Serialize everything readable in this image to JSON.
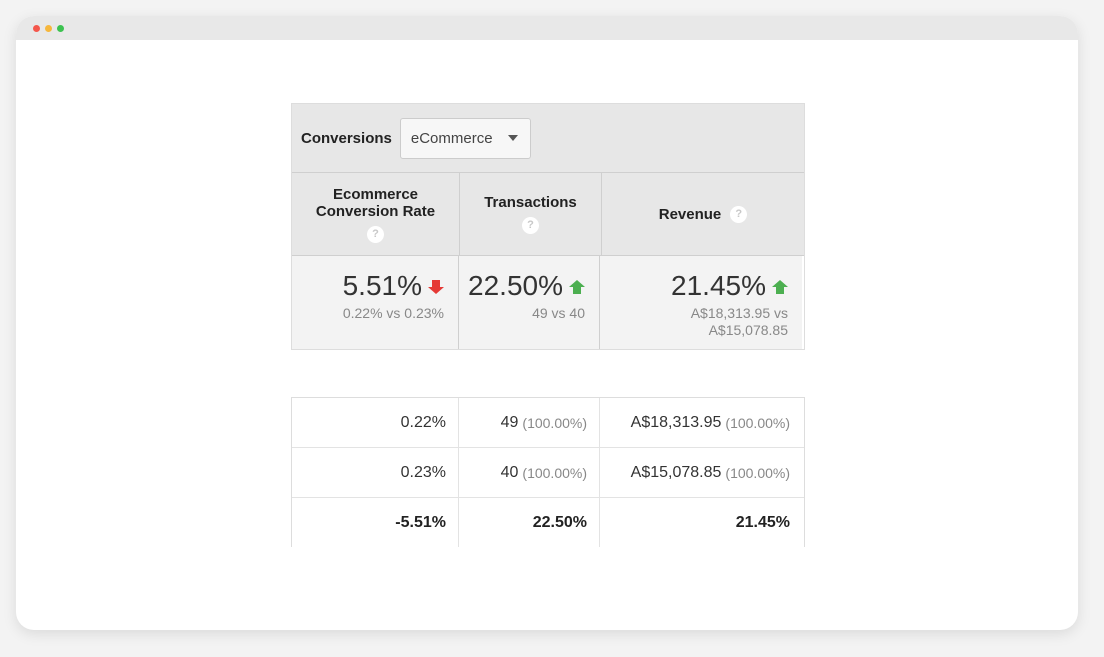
{
  "colors": {
    "red_dot": "#f4574c",
    "yellow_dot": "#f6b73c",
    "green_dot": "#3cc250",
    "down_arrow": "#e53935",
    "up_arrow": "#4caf50"
  },
  "conversions": {
    "label": "Conversions",
    "selected": "eCommerce"
  },
  "summary": {
    "headers": [
      {
        "line1": "Ecommerce",
        "line2": "Conversion Rate",
        "help": "?"
      },
      {
        "label": "Transactions",
        "help": "?"
      },
      {
        "label": "Revenue",
        "help": "?"
      }
    ],
    "metrics": [
      {
        "value": "5.51%",
        "trend": "down",
        "compare": "0.22% vs 0.23%"
      },
      {
        "value": "22.50%",
        "trend": "up",
        "compare": "49 vs 40"
      },
      {
        "value": "21.45%",
        "trend": "up",
        "compare_line1": "A$18,313.95 vs",
        "compare_line2": "A$15,078.85"
      }
    ]
  },
  "detail_rows": [
    {
      "rate": "0.22%",
      "transactions": "49",
      "transactions_pct": "(100.00%)",
      "revenue": "A$18,313.95",
      "revenue_pct": "(100.00%)"
    },
    {
      "rate": "0.23%",
      "transactions": "40",
      "transactions_pct": "(100.00%)",
      "revenue": "A$15,078.85",
      "revenue_pct": "(100.00%)"
    },
    {
      "rate": "-5.51%",
      "transactions": "22.50%",
      "revenue": "21.45%"
    }
  ]
}
